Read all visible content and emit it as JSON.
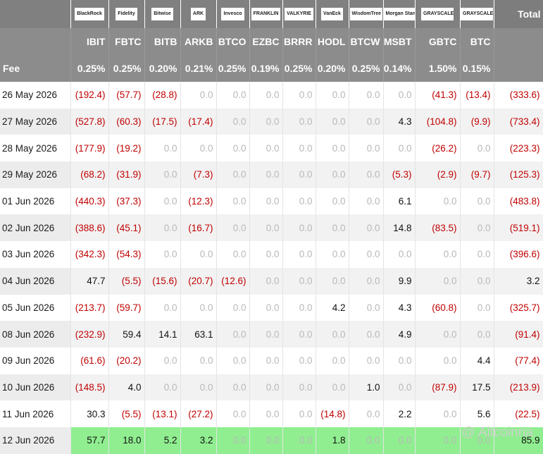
{
  "logos": [
    {
      "label": "BlackRock",
      "bold": true
    },
    {
      "label": "Fidelity",
      "bold": false
    },
    {
      "label": "Bitwise",
      "bold": false
    },
    {
      "label": "ARK",
      "bold": false
    },
    {
      "label": "Invesco",
      "bold": false
    },
    {
      "label": "FRANKLIN",
      "bold": false
    },
    {
      "label": "VALKYRIE",
      "bold": true
    },
    {
      "label": "VanEck",
      "bold": true
    },
    {
      "label": "WisdomTree",
      "bold": false
    },
    {
      "label": "Morgan Stanley",
      "bold": false
    },
    {
      "label": "GRAYSCALE",
      "bold": false
    },
    {
      "label": "GRAYSCALE",
      "bold": false
    }
  ],
  "total_header": "Total",
  "tickers": [
    "IBIT",
    "FBTC",
    "BITB",
    "ARKB",
    "BTCO",
    "EZBC",
    "BRRR",
    "HODL",
    "BTCW",
    "MSBT",
    "GBTC",
    "BTC"
  ],
  "fee_label": "Fee",
  "fees": [
    "0.25%",
    "0.25%",
    "0.20%",
    "0.21%",
    "0.25%",
    "0.19%",
    "0.25%",
    "0.20%",
    "0.25%",
    "0.14%",
    "1.50%",
    "0.15%"
  ],
  "rows": [
    {
      "date": "26 May 2026",
      "values": [
        "(192.4)",
        "(57.7)",
        "(28.8)",
        "0.0",
        "0.0",
        "0.0",
        "0.0",
        "0.0",
        "0.0",
        "0.0",
        "(41.3)",
        "(13.4)"
      ],
      "total": "(333.6)"
    },
    {
      "date": "27 May 2026",
      "values": [
        "(527.8)",
        "(60.3)",
        "(17.5)",
        "(17.4)",
        "0.0",
        "0.0",
        "0.0",
        "0.0",
        "0.0",
        "4.3",
        "(104.8)",
        "(9.9)"
      ],
      "total": "(733.4)"
    },
    {
      "date": "28 May 2026",
      "values": [
        "(177.9)",
        "(19.2)",
        "0.0",
        "0.0",
        "0.0",
        "0.0",
        "0.0",
        "0.0",
        "0.0",
        "0.0",
        "(26.2)",
        "0.0"
      ],
      "total": "(223.3)"
    },
    {
      "date": "29 May 2026",
      "values": [
        "(68.2)",
        "(31.9)",
        "0.0",
        "(7.3)",
        "0.0",
        "0.0",
        "0.0",
        "0.0",
        "0.0",
        "(5.3)",
        "(2.9)",
        "(9.7)"
      ],
      "total": "(125.3)"
    },
    {
      "date": "01 Jun 2026",
      "values": [
        "(440.3)",
        "(37.3)",
        "0.0",
        "(12.3)",
        "0.0",
        "0.0",
        "0.0",
        "0.0",
        "0.0",
        "6.1",
        "0.0",
        "0.0"
      ],
      "total": "(483.8)"
    },
    {
      "date": "02 Jun 2026",
      "values": [
        "(388.6)",
        "(45.1)",
        "0.0",
        "(16.7)",
        "0.0",
        "0.0",
        "0.0",
        "0.0",
        "0.0",
        "14.8",
        "(83.5)",
        "0.0"
      ],
      "total": "(519.1)"
    },
    {
      "date": "03 Jun 2026",
      "values": [
        "(342.3)",
        "(54.3)",
        "0.0",
        "0.0",
        "0.0",
        "0.0",
        "0.0",
        "0.0",
        "0.0",
        "0.0",
        "0.0",
        "0.0"
      ],
      "total": "(396.6)"
    },
    {
      "date": "04 Jun 2026",
      "values": [
        "47.7",
        "(5.5)",
        "(15.6)",
        "(20.7)",
        "(12.6)",
        "0.0",
        "0.0",
        "0.0",
        "0.0",
        "9.9",
        "0.0",
        "0.0"
      ],
      "total": "3.2"
    },
    {
      "date": "05 Jun 2026",
      "values": [
        "(213.7)",
        "(59.7)",
        "0.0",
        "0.0",
        "0.0",
        "0.0",
        "0.0",
        "4.2",
        "0.0",
        "4.3",
        "(60.8)",
        "0.0"
      ],
      "total": "(325.7)"
    },
    {
      "date": "08 Jun 2026",
      "values": [
        "(232.9)",
        "59.4",
        "14.1",
        "63.1",
        "0.0",
        "0.0",
        "0.0",
        "0.0",
        "0.0",
        "4.9",
        "0.0",
        "0.0"
      ],
      "total": "(91.4)"
    },
    {
      "date": "09 Jun 2026",
      "values": [
        "(61.6)",
        "(20.2)",
        "0.0",
        "0.0",
        "0.0",
        "0.0",
        "0.0",
        "0.0",
        "0.0",
        "0.0",
        "0.0",
        "4.4"
      ],
      "total": "(77.4)"
    },
    {
      "date": "10 Jun 2026",
      "values": [
        "(148.5)",
        "4.0",
        "0.0",
        "0.0",
        "0.0",
        "0.0",
        "0.0",
        "0.0",
        "1.0",
        "0.0",
        "(87.9)",
        "17.5"
      ],
      "total": "(213.9)"
    },
    {
      "date": "11 Jun 2026",
      "values": [
        "30.3",
        "(5.5)",
        "(13.1)",
        "(27.2)",
        "0.0",
        "0.0",
        "0.0",
        "(14.8)",
        "0.0",
        "2.2",
        "0.0",
        "5.6"
      ],
      "total": "(22.5)"
    },
    {
      "date": "12 Jun 2026",
      "values": [
        "57.7",
        "18.0",
        "5.2",
        "3.2",
        "0.0",
        "0.0",
        "0.0",
        "1.8",
        "0.0",
        "0.0",
        "0.0",
        "0.0"
      ],
      "total": "85.9",
      "highlight": true
    }
  ],
  "watermark": "@ Altcoinna",
  "colors": {
    "header_bg": "#808080",
    "ticker_bg": "#8c8c8c",
    "negative": "#c00000",
    "zero": "#b8b8b8",
    "stripe": "#f2f2f2",
    "highlight": "#90ee90"
  }
}
